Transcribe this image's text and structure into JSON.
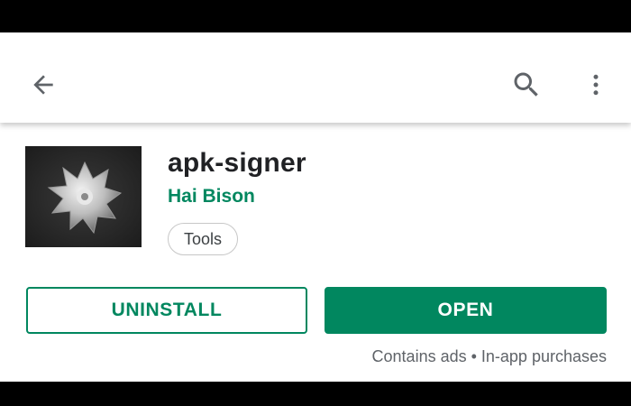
{
  "toolbar": {
    "back_icon": "arrow-back-icon",
    "search_icon": "search-icon",
    "more_icon": "more-vert-icon"
  },
  "app": {
    "icon": "app-icon-gear",
    "title": "apk-signer",
    "developer": "Hai Bison",
    "category": "Tools"
  },
  "actions": {
    "uninstall_label": "UNINSTALL",
    "open_label": "OPEN"
  },
  "meta": {
    "text": "Contains ads • In-app purchases"
  },
  "colors": {
    "accent": "#01875f",
    "title": "#202124",
    "secondary": "#5f6368",
    "letterbox": "#000000"
  }
}
